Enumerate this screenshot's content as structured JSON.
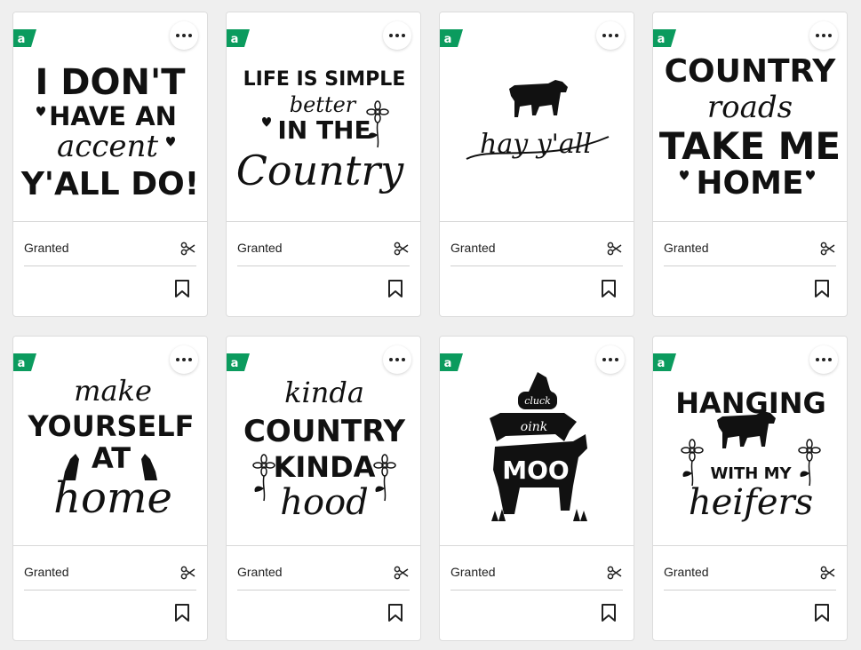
{
  "cards": [
    {
      "status": "Granted",
      "art": {
        "lines": [
          "I DON'T",
          "HAVE AN",
          "accent",
          "Y'ALL DO!"
        ]
      }
    },
    {
      "status": "Granted",
      "art": {
        "lines": [
          "LIFE IS SIMPLE",
          "better",
          "IN THE",
          "Country"
        ]
      }
    },
    {
      "status": "Granted",
      "art": {
        "lines": [
          "hay y'all"
        ]
      }
    },
    {
      "status": "Granted",
      "art": {
        "lines": [
          "COUNTRY",
          "roads",
          "TAKE ME",
          "HOME"
        ]
      }
    },
    {
      "status": "Granted",
      "art": {
        "lines": [
          "make",
          "YOURSELF",
          "AT",
          "home"
        ]
      }
    },
    {
      "status": "Granted",
      "art": {
        "lines": [
          "kinda",
          "COUNTRY",
          "KINDA",
          "hood"
        ]
      }
    },
    {
      "status": "Granted",
      "art": {
        "lines": [
          "cluck",
          "oink",
          "MOO"
        ]
      }
    },
    {
      "status": "Granted",
      "art": {
        "lines": [
          "HANGING",
          "WITH MY",
          "heifers"
        ]
      }
    }
  ],
  "badge": {
    "glyph": "a",
    "color": "#0b9b5e"
  },
  "icons": {
    "more": "more-options-icon",
    "cut": "scissors-icon",
    "save": "bookmark-icon",
    "access": "access-badge-icon"
  }
}
